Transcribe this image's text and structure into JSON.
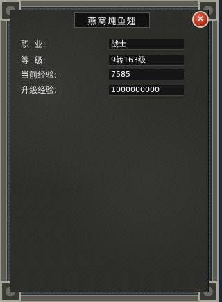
{
  "window": {
    "title": "燕窝炖鱼翅",
    "close_glyph": "✕"
  },
  "rows": [
    {
      "label": "职  业:",
      "value": "战士"
    },
    {
      "label": "等  级:",
      "value": "9转163级"
    },
    {
      "label": "当前经验:",
      "value": "7585"
    },
    {
      "label": "升级经验:",
      "value": "1000000000"
    }
  ],
  "colors": {
    "panel": "#2c2c29",
    "title_bg": "#111111",
    "close_button": "#c23a26"
  },
  "icons": [
    "close-icon"
  ]
}
